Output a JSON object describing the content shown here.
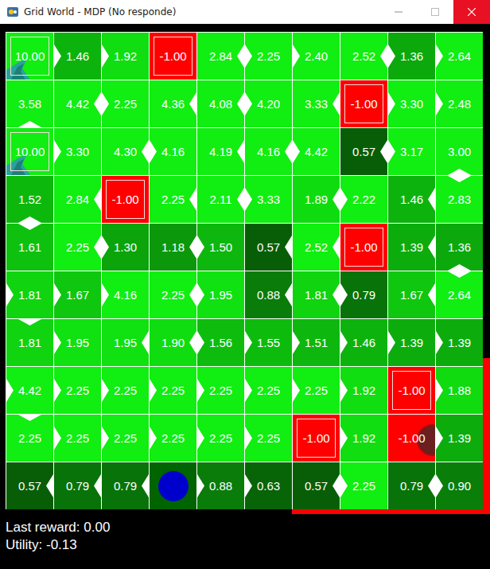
{
  "window": {
    "title": "Grid World - MDP (No responde)"
  },
  "grid": {
    "rows": [
      [
        {
          "value": "10.00",
          "kind": "goal",
          "notch": "none"
        },
        {
          "value": "1.46",
          "kind": "state",
          "notch": "left"
        },
        {
          "value": "1.92",
          "kind": "state",
          "notch": "left"
        },
        {
          "value": "-1.00",
          "kind": "terminal",
          "notch": "none"
        },
        {
          "value": "2.84",
          "kind": "state",
          "notch": "right"
        },
        {
          "value": "2.25",
          "kind": "state",
          "notch": "left"
        },
        {
          "value": "2.40",
          "kind": "state",
          "notch": "left"
        },
        {
          "value": "2.52",
          "kind": "state",
          "notch": "right"
        },
        {
          "value": "1.36",
          "kind": "state",
          "notch": "left"
        },
        {
          "value": "2.64",
          "kind": "state",
          "notch": "left"
        }
      ],
      [
        {
          "value": "3.58",
          "kind": "state",
          "notch": "bottom"
        },
        {
          "value": "4.42",
          "kind": "state",
          "notch": "right"
        },
        {
          "value": "2.25",
          "kind": "state",
          "notch": "left"
        },
        {
          "value": "4.36",
          "kind": "state",
          "notch": "right"
        },
        {
          "value": "4.08",
          "kind": "state",
          "notch": "right"
        },
        {
          "value": "4.20",
          "kind": "state",
          "notch": "left"
        },
        {
          "value": "3.33",
          "kind": "state",
          "notch": "right"
        },
        {
          "value": "-1.00",
          "kind": "terminal",
          "notch": "none"
        },
        {
          "value": "3.30",
          "kind": "state",
          "notch": "left"
        },
        {
          "value": "2.48",
          "kind": "state",
          "notch": "left"
        }
      ],
      [
        {
          "value": "10.00",
          "kind": "goal",
          "notch": "none"
        },
        {
          "value": "3.30",
          "kind": "state",
          "notch": "left"
        },
        {
          "value": "4.30",
          "kind": "state",
          "notch": "right"
        },
        {
          "value": "4.16",
          "kind": "state",
          "notch": "left"
        },
        {
          "value": "4.19",
          "kind": "state",
          "notch": "right"
        },
        {
          "value": "4.16",
          "kind": "state",
          "notch": "right"
        },
        {
          "value": "4.42",
          "kind": "state",
          "notch": "left"
        },
        {
          "value": "0.57",
          "kind": "state",
          "notch": "right"
        },
        {
          "value": "3.17",
          "kind": "state",
          "notch": "left"
        },
        {
          "value": "3.00",
          "kind": "state",
          "notch": "bottom"
        }
      ],
      [
        {
          "value": "1.52",
          "kind": "state",
          "notch": "bottom"
        },
        {
          "value": "2.84",
          "kind": "state",
          "notch": "right"
        },
        {
          "value": "-1.00",
          "kind": "terminal",
          "notch": "none"
        },
        {
          "value": "2.25",
          "kind": "state",
          "notch": "right"
        },
        {
          "value": "2.11",
          "kind": "state",
          "notch": "right"
        },
        {
          "value": "3.33",
          "kind": "state",
          "notch": "left"
        },
        {
          "value": "1.89",
          "kind": "state",
          "notch": "right"
        },
        {
          "value": "2.22",
          "kind": "state",
          "notch": "left"
        },
        {
          "value": "1.46",
          "kind": "state",
          "notch": "right"
        },
        {
          "value": "2.83",
          "kind": "state",
          "notch": "top"
        }
      ],
      [
        {
          "value": "1.61",
          "kind": "state",
          "notch": "top"
        },
        {
          "value": "2.25",
          "kind": "state",
          "notch": "right"
        },
        {
          "value": "1.30",
          "kind": "state",
          "notch": "left"
        },
        {
          "value": "1.18",
          "kind": "state",
          "notch": "right"
        },
        {
          "value": "1.50",
          "kind": "state",
          "notch": "left"
        },
        {
          "value": "0.57",
          "kind": "state",
          "notch": "right"
        },
        {
          "value": "2.52",
          "kind": "state",
          "notch": "right"
        },
        {
          "value": "-1.00",
          "kind": "terminal",
          "notch": "none"
        },
        {
          "value": "1.39",
          "kind": "state",
          "notch": "right"
        },
        {
          "value": "1.36",
          "kind": "state",
          "notch": "bottom"
        }
      ],
      [
        {
          "value": "1.81",
          "kind": "state",
          "notch": "left"
        },
        {
          "value": "1.67",
          "kind": "state",
          "notch": "left"
        },
        {
          "value": "4.16",
          "kind": "state",
          "notch": "left"
        },
        {
          "value": "2.25",
          "kind": "state",
          "notch": "right"
        },
        {
          "value": "1.95",
          "kind": "state",
          "notch": "left"
        },
        {
          "value": "0.88",
          "kind": "state",
          "notch": "right"
        },
        {
          "value": "1.81",
          "kind": "state",
          "notch": "right"
        },
        {
          "value": "0.79",
          "kind": "state",
          "notch": "left"
        },
        {
          "value": "1.67",
          "kind": "state",
          "notch": "right"
        },
        {
          "value": "2.64",
          "kind": "state",
          "notch": "top"
        }
      ],
      [
        {
          "value": "1.81",
          "kind": "state",
          "notch": "top"
        },
        {
          "value": "1.95",
          "kind": "state",
          "notch": "left"
        },
        {
          "value": "1.95",
          "kind": "state",
          "notch": "right"
        },
        {
          "value": "1.90",
          "kind": "state",
          "notch": "right"
        },
        {
          "value": "1.56",
          "kind": "state",
          "notch": "left"
        },
        {
          "value": "1.55",
          "kind": "state",
          "notch": "left"
        },
        {
          "value": "1.51",
          "kind": "state",
          "notch": "left"
        },
        {
          "value": "1.46",
          "kind": "state",
          "notch": "left"
        },
        {
          "value": "1.39",
          "kind": "state",
          "notch": "left"
        },
        {
          "value": "1.39",
          "kind": "state",
          "notch": "left"
        }
      ],
      [
        {
          "value": "4.42",
          "kind": "state",
          "notch": "left"
        },
        {
          "value": "2.25",
          "kind": "state",
          "notch": "left"
        },
        {
          "value": "2.25",
          "kind": "state",
          "notch": "left"
        },
        {
          "value": "2.25",
          "kind": "state",
          "notch": "left"
        },
        {
          "value": "2.25",
          "kind": "state",
          "notch": "left"
        },
        {
          "value": "2.25",
          "kind": "state",
          "notch": "left"
        },
        {
          "value": "2.25",
          "kind": "state",
          "notch": "left"
        },
        {
          "value": "1.92",
          "kind": "state",
          "notch": "left"
        },
        {
          "value": "-1.00",
          "kind": "terminal",
          "notch": "none"
        },
        {
          "value": "1.88",
          "kind": "state",
          "notch": "left"
        }
      ],
      [
        {
          "value": "2.25",
          "kind": "state",
          "notch": "top"
        },
        {
          "value": "2.25",
          "kind": "state",
          "notch": "left"
        },
        {
          "value": "2.25",
          "kind": "state",
          "notch": "left"
        },
        {
          "value": "2.25",
          "kind": "state",
          "notch": "left"
        },
        {
          "value": "2.25",
          "kind": "state",
          "notch": "left"
        },
        {
          "value": "2.25",
          "kind": "state",
          "notch": "left"
        },
        {
          "value": "-1.00",
          "kind": "terminal",
          "notch": "none"
        },
        {
          "value": "1.92",
          "kind": "state",
          "notch": "left"
        },
        {
          "value": "-1.00",
          "kind": "enemy",
          "notch": "none"
        },
        {
          "value": "1.39",
          "kind": "state",
          "notch": "left"
        }
      ],
      [
        {
          "value": "0.57",
          "kind": "state",
          "notch": "right"
        },
        {
          "value": "0.79",
          "kind": "state",
          "notch": "right"
        },
        {
          "value": "0.79",
          "kind": "state",
          "notch": "right"
        },
        {
          "value": "",
          "kind": "agent",
          "notch": "none"
        },
        {
          "value": "0.88",
          "kind": "state",
          "notch": "left"
        },
        {
          "value": "0.63",
          "kind": "state",
          "notch": "left"
        },
        {
          "value": "0.57",
          "kind": "state",
          "notch": "right"
        },
        {
          "value": "2.25",
          "kind": "state",
          "notch": "left"
        },
        {
          "value": "0.79",
          "kind": "state",
          "notch": "right"
        },
        {
          "value": "0.90",
          "kind": "state",
          "notch": "left"
        }
      ]
    ]
  },
  "status": {
    "last_reward": "Last reward: 0.00",
    "utility": "Utility: -0.13"
  }
}
